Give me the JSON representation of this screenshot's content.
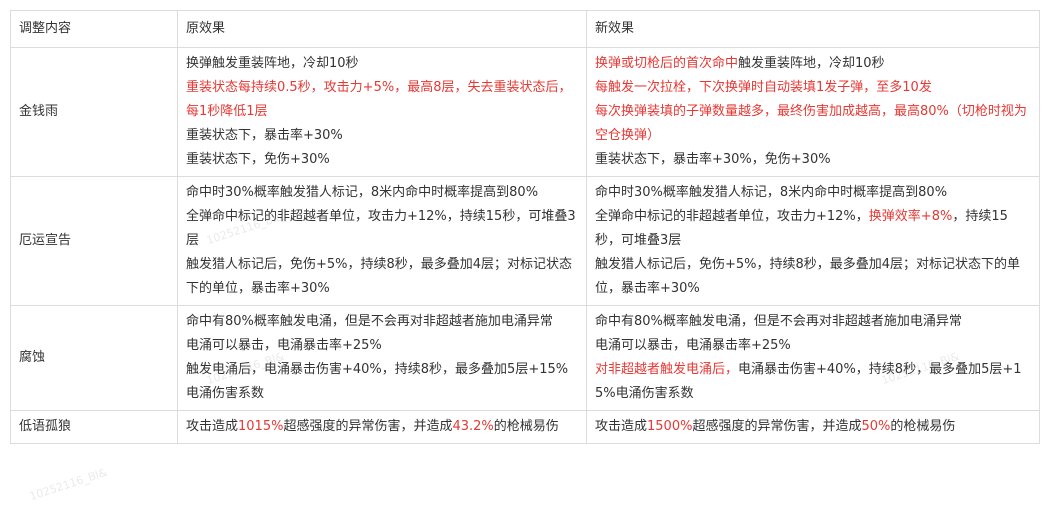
{
  "table": {
    "headers": [
      "调整内容",
      "原效果",
      "新效果"
    ],
    "rows": [
      {
        "name": "金钱雨",
        "orig": [
          [
            {
              "t": "换弹触发重装阵地，冷却10秒"
            }
          ],
          [
            {
              "t": "重装状态每持续0.5秒，攻击力+5%，最高8层，失去重装状态后，每1秒降低1层",
              "hl": true
            }
          ],
          [
            {
              "t": "重装状态下，暴击率+30%"
            }
          ],
          [
            {
              "t": "重装状态下，免伤+30%"
            }
          ]
        ],
        "new": [
          [
            {
              "t": "换弹或切枪后的首次命中",
              "hl": true
            },
            {
              "t": "触发重装阵地，冷却10秒"
            }
          ],
          [
            {
              "t": "每触发一次拉栓，下次换弹时自动装填1发子弹，至多10发",
              "hl": true
            }
          ],
          [
            {
              "t": "每次换弹装填的子弹数量越多，最终伤害加成越高，最高80%（切枪时视为空仓换弹）",
              "hl": true
            }
          ],
          [
            {
              "t": "重装状态下，暴击率+30%，免伤+30%"
            }
          ]
        ]
      },
      {
        "name": "厄运宣告",
        "orig": [
          [
            {
              "t": "命中时30%概率触发猎人标记，8米内命中时概率提高到80%"
            }
          ],
          [
            {
              "t": "全弹命中标记的非超越者单位，攻击力+12%，持续15秒，可堆叠3层"
            }
          ],
          [
            {
              "t": "触发猎人标记后，免伤+5%，持续8秒，最多叠加4层；对标记状态下的单位，暴击率+30%"
            }
          ]
        ],
        "new": [
          [
            {
              "t": "命中时30%概率触发猎人标记，8米内命中时概率提高到80%"
            }
          ],
          [
            {
              "t": "全弹命中标记的非超越者单位，攻击力+12%，"
            },
            {
              "t": "换弹效率+8%",
              "hl": true
            },
            {
              "t": "，持续15秒，可堆叠3层"
            }
          ],
          [
            {
              "t": "触发猎人标记后，免伤+5%，持续8秒，最多叠加4层；对标记状态下的单位，暴击率+30%"
            }
          ]
        ]
      },
      {
        "name": "腐蚀",
        "orig": [
          [
            {
              "t": "命中有80%概率触发电涌，但是不会再对非超越者施加电涌异常"
            }
          ],
          [
            {
              "t": "电涌可以暴击，电涌暴击率+25%"
            }
          ],
          [
            {
              "t": "触发电涌后，电涌暴击伤害+40%，持续8秒，最多叠加5层+15%电涌伤害系数"
            }
          ]
        ],
        "new": [
          [
            {
              "t": "命中有80%概率触发电涌，但是不会再对非超越者施加电涌异常"
            }
          ],
          [
            {
              "t": "电涌可以暴击，电涌暴击率+25%"
            }
          ],
          [
            {
              "t": "对非超越者触发电涌后，",
              "hl": true
            },
            {
              "t": "电涌暴击伤害+40%，持续8秒，最多叠加5层+15%电涌伤害系数"
            }
          ]
        ]
      },
      {
        "name": "低语孤狼",
        "orig": [
          [
            {
              "t": "攻击造成"
            },
            {
              "t": "1015%",
              "hl": true
            },
            {
              "t": "超感强度的异常伤害，并造成"
            },
            {
              "t": "43.2%",
              "hl": true
            },
            {
              "t": "的枪械易伤"
            }
          ]
        ],
        "new": [
          [
            {
              "t": "攻击造成"
            },
            {
              "t": "1500%",
              "hl": true
            },
            {
              "t": "超感强度的异常伤害，并造成"
            },
            {
              "t": "50%",
              "hl": true
            },
            {
              "t": "的枪械易伤"
            }
          ]
        ]
      }
    ]
  },
  "colors": {
    "highlight": "#e53935",
    "text": "#333333",
    "border": "#dcdcdc"
  }
}
